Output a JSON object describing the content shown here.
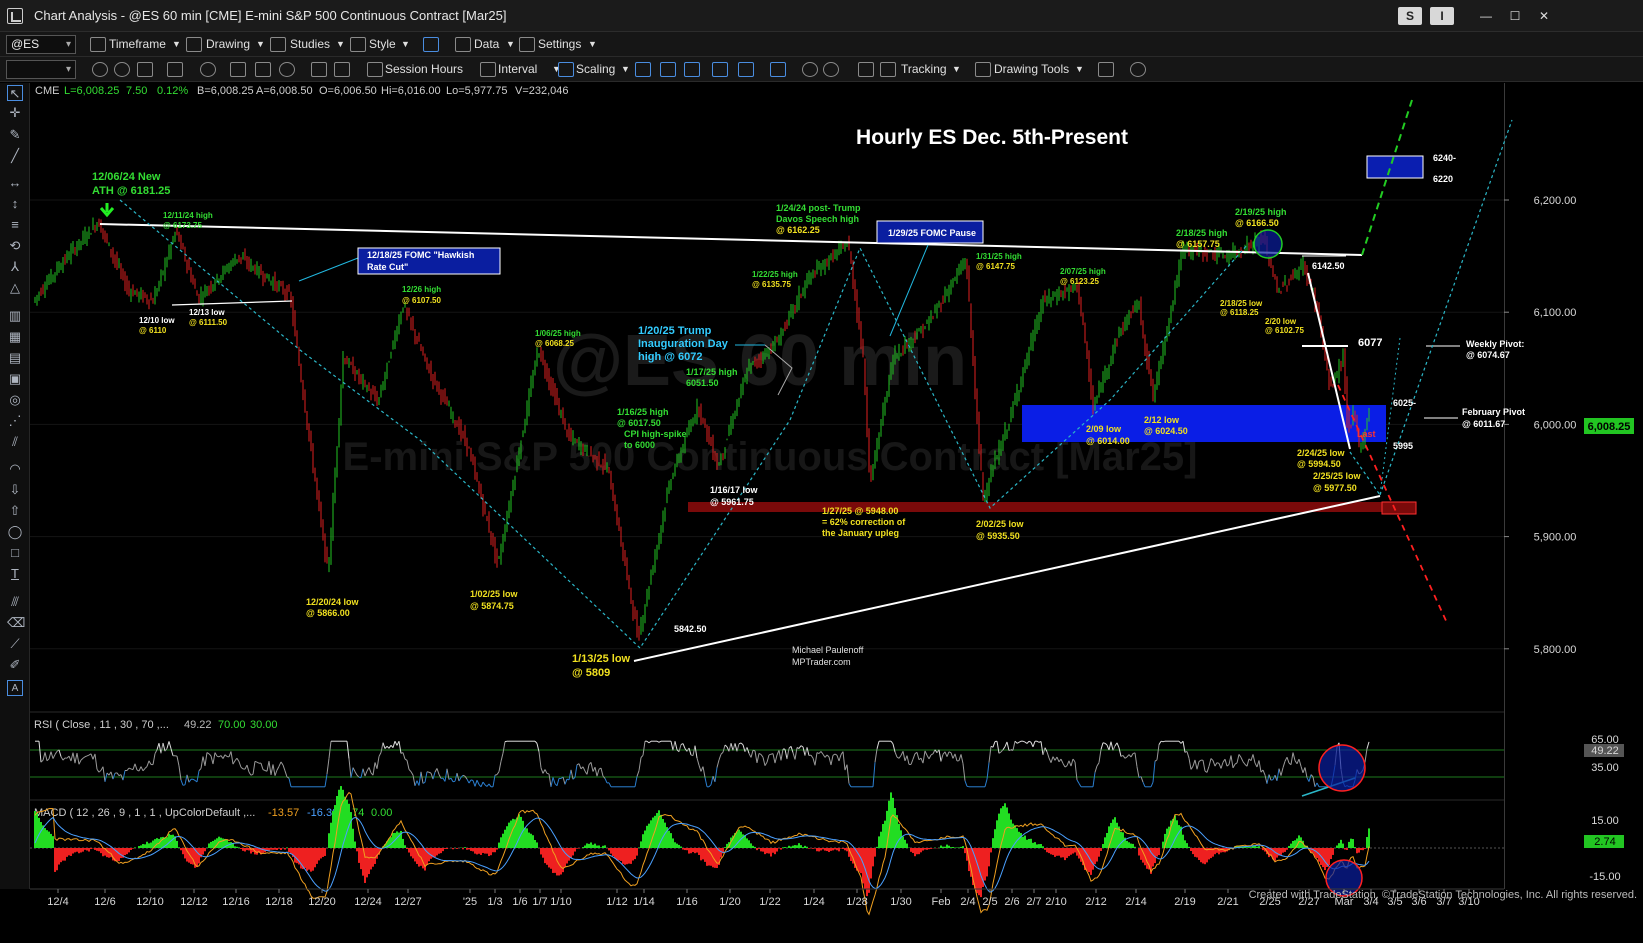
{
  "window": {
    "title": "Chart Analysis - @ES 60 min [CME] E-mini S&P 500 Continuous Contract [Mar25]",
    "s_button": "S",
    "i_button": "I",
    "minimize": "—",
    "maximize": "☐",
    "close": "✕"
  },
  "toolbar1": {
    "symbol_value": "@ES",
    "timeframe": "Timeframe",
    "drawing": "Drawing",
    "studies": "Studies",
    "style": "Style",
    "data": "Data",
    "settings": "Settings"
  },
  "toolbar2": {
    "session_hours": "Session Hours",
    "interval": "Interval",
    "scaling": "Scaling",
    "tracking": "Tracking",
    "drawing_tools": "Drawing Tools"
  },
  "quote": {
    "exchange": "CME",
    "last": "L=6,008.25",
    "change": "7.50",
    "pct": "0.12%",
    "bid": "B=6,008.25",
    "ask": "A=6,008.50",
    "open": "O=6,006.50",
    "high": "Hi=6,016.00",
    "low": "Lo=5,977.75",
    "volume": "V=232,046"
  },
  "chart": {
    "title": "Hourly ES Dec. 5th-Present",
    "watermark1": "@ES 60 min",
    "watermark2": "E-mini S&P 500 Continuous Contract [Mar25]",
    "author1": "Michael Paulenoff",
    "author2": "MPTrader.com",
    "last_flag": "Last",
    "current_price": "6,008.25"
  },
  "price_axis": [
    "6,200.00",
    "6,100.00",
    "6,000.00",
    "5,900.00",
    "5,800.00"
  ],
  "date_axis": [
    "12/4",
    "12/6",
    "12/10",
    "12/12",
    "12/16",
    "12/18",
    "12/20",
    "12/24",
    "12/27",
    "'25",
    "1/3",
    "1/6",
    "1/7",
    "1/10",
    "1/12",
    "1/14",
    "1/16",
    "1/20",
    "1/22",
    "1/24",
    "1/28",
    "1/30",
    "Feb",
    "2/4",
    "2/5",
    "2/6",
    "2/7",
    "2/10",
    "2/12",
    "2/14",
    "2/19",
    "2/21",
    "2/25",
    "2/27",
    "Mar",
    "3/4",
    "3/5",
    "3/6",
    "3/7",
    "3/10"
  ],
  "annotations": {
    "ath1": "12/06/24 New",
    "ath2": "ATH @ 6181.25",
    "h1211a": "12/11/24 high",
    "h1211b": "@ 6173.75",
    "l1210a": "12/10 low",
    "l1210b": "@ 6110",
    "l1213a": "12/13 low",
    "l1213b": "@ 6111.50",
    "fomc1a": "12/18/25 FOMC \"Hawkish",
    "fomc1b": "Rate Cut\"",
    "h1226a": "12/26 high",
    "h1226b": "@ 6107.50",
    "l1220a": "12/20/24 low",
    "l1220b": "@ 5866.00",
    "l0102a": "1/02/25 low",
    "l0102b": "@ 5874.75",
    "h0106a": "1/06/25 high",
    "h0106b": "@ 6068.25",
    "l0113a": "1/13/25 low",
    "l0113b": "@ 5809",
    "v5842": "5842.50",
    "h0116a": "1/16/25 high",
    "h0116b": "@ 6017.50",
    "h0116c": "CPI high-spike",
    "h0116d": "to 6000",
    "trump1": "1/20/25 Trump",
    "trump2": "Inauguration Day",
    "trump3": "high @ 6072",
    "h0117a": "1/17/25 high",
    "h0117b": "6051.50",
    "l0116a": "1/16/17 low",
    "l0116b": "@ 5961.75",
    "h0122a": "1/22/25 high",
    "h0122b": "@ 6135.75",
    "davos1": "1/24/24 post- Trump",
    "davos2": "Davos Speech high",
    "davos3": "@ 6162.25",
    "fomc2": "1/29/25 FOMC Pause",
    "corr1": "1/27/25 @ 5948.00",
    "corr2": "= 62% correction of",
    "corr3": "the January upleg",
    "h0131a": "1/31/25 high",
    "h0131b": "@ 6147.75",
    "l0202a": "2/02/25 low",
    "l0202b": "@ 5935.50",
    "h0207a": "2/07/25 high",
    "h0207b": "@ 6123.25",
    "l0209a": "2/09 low",
    "l0209b": "@ 6014.00",
    "l0212a": "2/12 low",
    "l0212b": "@ 6024.50",
    "h0218a": "2/18/25 high",
    "h0218b": "@ 6157.75",
    "h0219a": "2/19/25 high",
    "h0219b": "@ 6166.50",
    "l0218a": "2/18/25 low",
    "l0218b": "@ 6118.25",
    "l0220a": "2/20 low",
    "l0220b": "@ 6102.75",
    "v6142": "6142.50",
    "v6077": "6077",
    "v6025": "6025-",
    "v5995": "5995",
    "l0224a": "2/24/25 low",
    "l0224b": "@ 5994.50",
    "l0225a": "2/25/25 low",
    "l0225b": "@ 5977.50",
    "v6240": "6240-",
    "v6220": "6220",
    "wp1": "Weekly Pivot:",
    "wp2": "@ 6074.67",
    "fp1": "February Pivot",
    "fp2": "@ 6011.67"
  },
  "rsi": {
    "label": "RSI ( Close , 11 , 30 , 70 ,...",
    "v1": "49.22",
    "v2": "70.00",
    "v3": "30.00",
    "axis": [
      "65.00",
      "49.22",
      "35.00"
    ]
  },
  "macd": {
    "label": "MACD ( 12 , 26 , 9 , 1 , 1 , UpColorDefault ,...",
    "v1": "-13.57",
    "v2": "-16.30",
    "v3": "2.74",
    "v4": "0.00",
    "axis": [
      "15.00",
      "2.74",
      "-15.00"
    ]
  },
  "footer": "Created with TradeStation. ©TradeStation Technologies, Inc. All rights reserved.",
  "colors": {
    "up": "#22c522",
    "down": "#e02020",
    "support_band": "#0a1ee6",
    "red_band": "#7a0a0a",
    "annotation_green": "#33dd33",
    "annotation_yellow": "#f0e020"
  }
}
